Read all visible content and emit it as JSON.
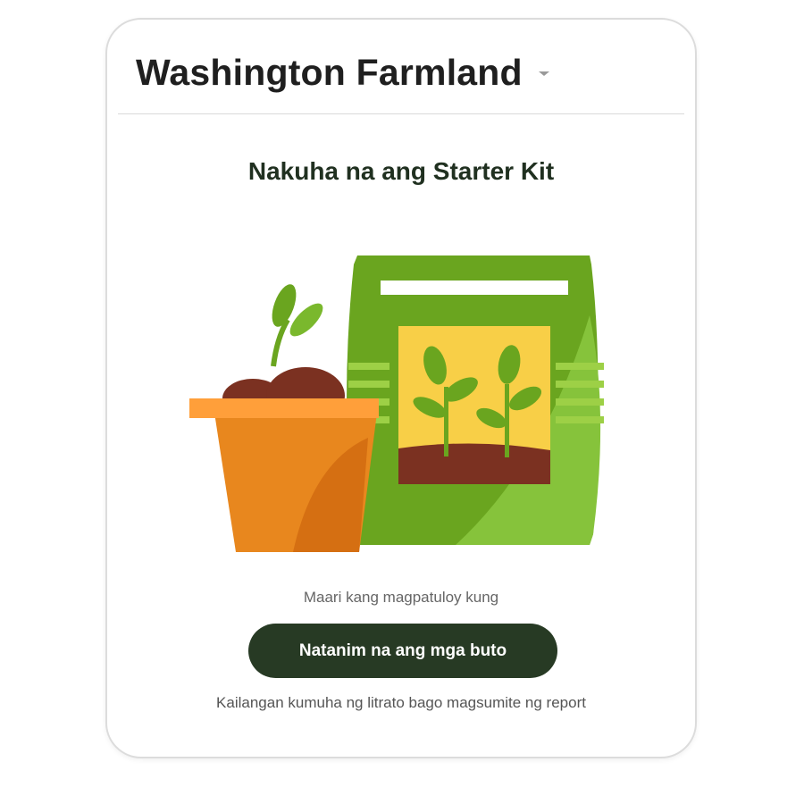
{
  "header": {
    "title": "Washington Farmland",
    "dropdown_icon": "chevron-down-icon"
  },
  "main": {
    "title": "Nakuha na ang Starter Kit",
    "illustration": "starter-kit-illustration",
    "hint": "Maari kang magpatuloy kung",
    "button_label": "Natanim na ang mga buto",
    "note": "Kailangan kumuha ng litrato bago magsumite ng report"
  },
  "colors": {
    "button": "#273a24",
    "pot": "#e8871e",
    "seed_bag": "#6aa51f",
    "soil": "#7b3121"
  }
}
